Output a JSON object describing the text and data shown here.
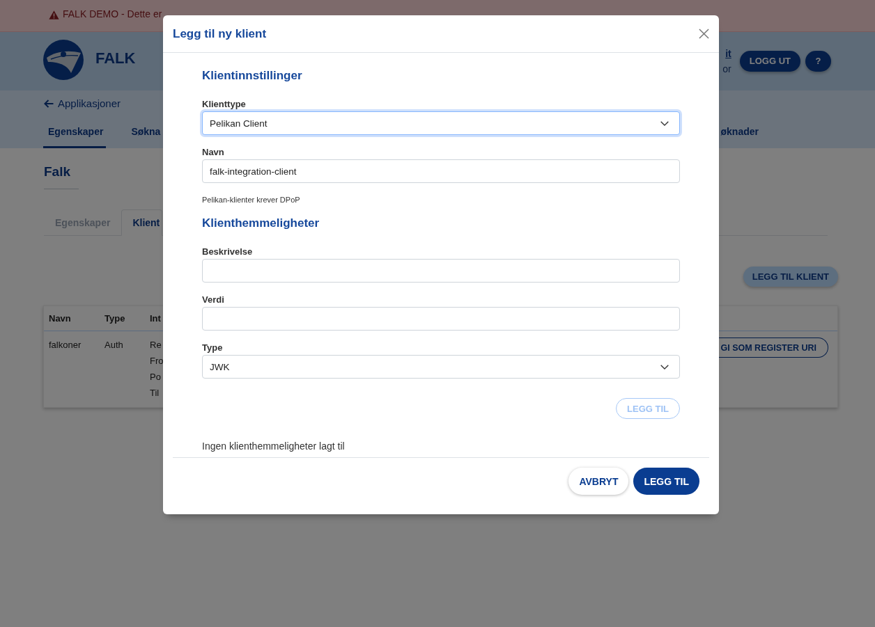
{
  "banner": {
    "text": "FALK DEMO - Dette er"
  },
  "header": {
    "app_name": "FALK",
    "user_link": "it",
    "user_role": "or",
    "buttons": [
      {
        "kind": "logout",
        "label": "LOGG UT"
      },
      {
        "kind": "help",
        "label": "?"
      }
    ]
  },
  "nav": {
    "back_link": "Applikasjoner",
    "tabs": [
      {
        "label": "Egenskaper",
        "selected": true
      },
      {
        "label": "Søkna",
        "selected": false
      },
      {
        "label": "øknader",
        "selected": false
      }
    ]
  },
  "page": {
    "title": "Falk",
    "tabs": [
      {
        "label": "Egenskaper",
        "selected": false
      },
      {
        "label": "Klient",
        "selected": true
      }
    ],
    "add_button": "LEGG TIL KLIENT",
    "table": {
      "columns": [
        "Navn",
        "Type",
        "Int"
      ],
      "rows": [
        {
          "name": "falkoner",
          "type": "Auth",
          "details": [
            "Re",
            "Fro",
            "Po",
            "Til"
          ],
          "action": "GI SOM REGISTER URI"
        }
      ]
    }
  },
  "dialog": {
    "title": "Legg til ny klient",
    "sections": [
      {
        "heading": "Klientinnstillinger",
        "fields": [
          {
            "kind": "select",
            "label": "Klienttype",
            "value": "Pelikan Client",
            "focused": true
          },
          {
            "kind": "text",
            "label": "Navn",
            "value": "falk-integration-client",
            "focused": false
          }
        ],
        "note": "Pelikan-klienter krever DPoP"
      },
      {
        "heading": "Klienthemmeligheter",
        "fields": [
          {
            "kind": "text",
            "label": "Beskrivelse",
            "focused": false
          },
          {
            "kind": "text",
            "label": "Verdi",
            "focused": false
          },
          {
            "kind": "select",
            "label": "Type",
            "value": "JWK",
            "focused": false
          }
        ],
        "add_button": {
          "label": "LEGG TIL",
          "disabled": true
        },
        "empty_text": "Ingen klienthemmeligheter lagt til"
      }
    ],
    "footer_buttons": [
      {
        "kind": "secondary",
        "label": "AVBRYT"
      },
      {
        "kind": "primary",
        "label": "LEGG TIL"
      }
    ]
  }
}
